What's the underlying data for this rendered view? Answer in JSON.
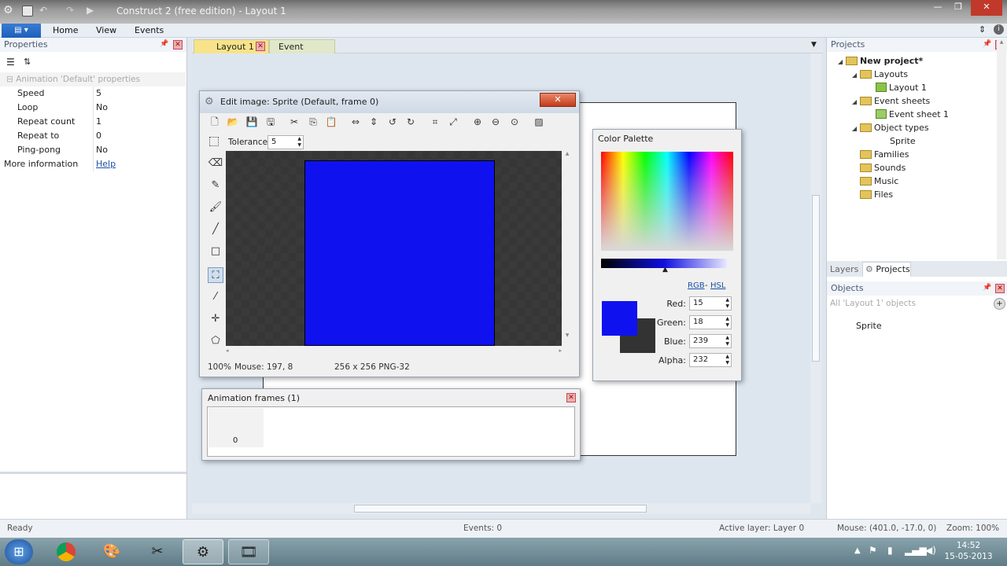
{
  "app": {
    "title": "Construct 2  (free edition) - Layout 1"
  },
  "ribbon": {
    "file_label": "▤ ▾",
    "tabs": [
      "Home",
      "View",
      "Events"
    ]
  },
  "properties": {
    "header": "Properties",
    "section": "Animation 'Default' properties",
    "rows": [
      {
        "key": "Speed",
        "value": "5"
      },
      {
        "key": "Loop",
        "value": "No"
      },
      {
        "key": "Repeat count",
        "value": "1"
      },
      {
        "key": "Repeat to",
        "value": "0"
      },
      {
        "key": "Ping-pong",
        "value": "No"
      }
    ],
    "more_info_label": "More information",
    "more_info_link": "Help"
  },
  "doc_tabs": [
    "Layout 1",
    "Event sheet 1"
  ],
  "edit_image": {
    "title": "Edit image: Sprite (Default, frame 0)",
    "tolerance_label": "Tolerance",
    "tolerance_value": "5",
    "status_zoom": "100%",
    "status_mouse": "Mouse: 197, 8",
    "status_size": "256 x 256  PNG-32"
  },
  "palette": {
    "title": "Color Palette",
    "rgb_link": "RGB",
    "dash": "-",
    "hsl_link": "HSL",
    "red_label": "Red:",
    "red": "15",
    "green_label": "Green:",
    "green": "18",
    "blue_label": "Blue:",
    "blue": "239",
    "alpha_label": "Alpha:",
    "alpha": "232",
    "selected_color": "#0f12ef"
  },
  "anim_frames": {
    "title": "Animation frames (1)",
    "frame0": "0"
  },
  "projects": {
    "header": "Projects",
    "root": "New project*",
    "layouts": "Layouts",
    "layout1": "Layout 1",
    "eventsheets": "Event sheets",
    "eventsheet1": "Event sheet 1",
    "objecttypes": "Object types",
    "sprite": "Sprite",
    "families": "Families",
    "sounds": "Sounds",
    "music": "Music",
    "files": "Files",
    "tab_layers": "Layers",
    "tab_projects": "Projects"
  },
  "objects": {
    "header": "Objects",
    "filter": "All 'Layout 1' objects",
    "item": "Sprite"
  },
  "status": {
    "ready": "Ready",
    "events": "Events: 0",
    "active_layer": "Active layer: Layer 0",
    "mouse": "Mouse: (401.0, -17.0, 0)",
    "zoom": "Zoom: 100%"
  },
  "clock": {
    "time": "14:52",
    "date": "15-05-2013"
  }
}
